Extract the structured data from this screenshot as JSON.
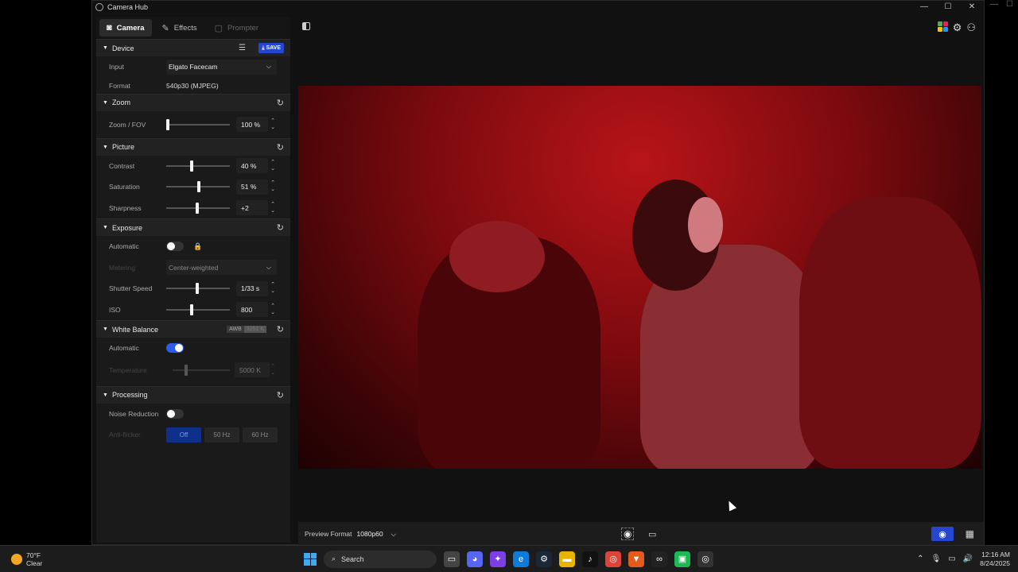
{
  "window": {
    "title": "Camera Hub",
    "controls": {
      "minimize": "—",
      "maximize": "☐",
      "close": "✕"
    }
  },
  "tabs": [
    {
      "label": "Camera",
      "icon": "camera-icon"
    },
    {
      "label": "Effects",
      "icon": "magic-wand-icon"
    },
    {
      "label": "Prompter",
      "icon": "prompter-icon"
    }
  ],
  "device": {
    "title": "Device",
    "save_label": "SAVE",
    "input_label": "Input",
    "input_value": "Elgato Facecam",
    "format_label": "Format",
    "format_value": "540p30 (MJPEG)"
  },
  "zoom": {
    "title": "Zoom",
    "label": "Zoom / FOV",
    "value": "100 %",
    "level": 0.0
  },
  "picture": {
    "title": "Picture",
    "contrast": {
      "label": "Contrast",
      "value": "40 %",
      "level": 0.4
    },
    "saturation": {
      "label": "Saturation",
      "value": "51 %",
      "level": 0.51
    },
    "sharpness": {
      "label": "Sharpness",
      "value": "+2",
      "level": 0.49
    }
  },
  "exposure": {
    "title": "Exposure",
    "automatic_label": "Automatic",
    "automatic_on": false,
    "metering_label": "Metering",
    "metering_value": "Center-weighted",
    "shutter": {
      "label": "Shutter Speed",
      "value": "1/33 s",
      "level": 0.49
    },
    "iso": {
      "label": "ISO",
      "value": "800",
      "level": 0.4
    }
  },
  "white_balance": {
    "title": "White Balance",
    "awb_label": "AWB",
    "awb_value": "3251 K",
    "automatic_label": "Automatic",
    "automatic_on": true,
    "temperature": {
      "label": "Temperature",
      "value": "5000 K",
      "level": 0.22
    }
  },
  "processing": {
    "title": "Processing",
    "noise_label": "Noise Reduction",
    "noise_on": false,
    "antiflicker_label": "Anti-flicker",
    "antiflicker_options": [
      "Off",
      "50 Hz",
      "60 Hz"
    ],
    "antiflicker_selected": "Off"
  },
  "preview": {
    "format_label": "Preview Format",
    "format_value": "1080p60"
  },
  "taskbar": {
    "weather_temp": "70°F",
    "weather_desc": "Clear",
    "search_placeholder": "Search",
    "time": "12:16 AM",
    "date": "8/24/2025"
  },
  "colors": {
    "accent": "#2547d0",
    "video_tint": "#b81418",
    "background": "#111111"
  }
}
